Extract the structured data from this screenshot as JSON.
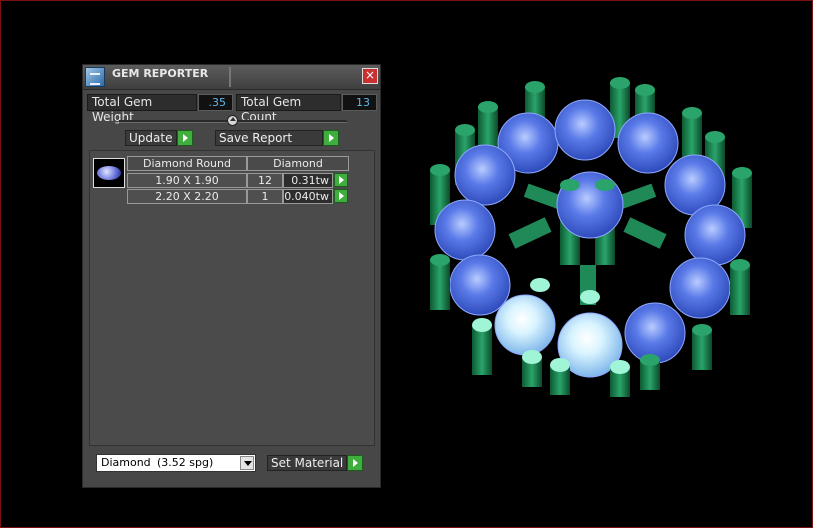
{
  "window": {
    "title": "GEM REPORTER",
    "close_symbol": "×"
  },
  "totals": {
    "weight_label": "Total Gem Weight",
    "weight_value": ".35",
    "count_label": "Total Gem Count",
    "count_value": "13"
  },
  "actions": {
    "update_label": "Update",
    "save_label": "Save Report"
  },
  "table": {
    "headers": [
      "Diamond Round",
      "Diamond"
    ],
    "rows": [
      {
        "size": "1.90 X 1.90",
        "count": "12",
        "weight": "0.31tw"
      },
      {
        "size": "2.20 X 2.20",
        "count": "1",
        "weight": "0.040tw"
      }
    ]
  },
  "material": {
    "selected": "Diamond",
    "ratio": "(3.52 spg)",
    "set_label": "Set Material"
  },
  "colors": {
    "accent_green": "#3fae3f",
    "value_blue": "#5fb7e8",
    "gem_blue": "#4d6ee0",
    "prong_green": "#1f8a58"
  }
}
